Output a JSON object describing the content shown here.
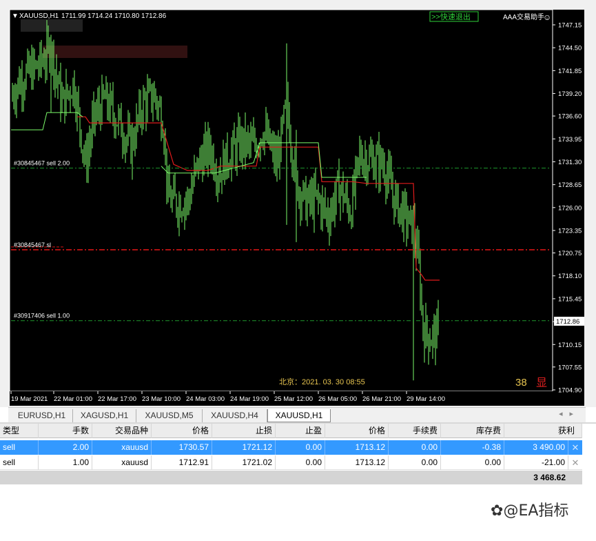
{
  "chart": {
    "symbol_info": "XAUUSD,H1",
    "ohlc": "1711.99 1714.24 1710.80 1712.86",
    "quick_exit_label": ">>快速退出",
    "assistant_label": "AAA交易助手",
    "beijing_time": "北京：2021. 03. 30  08:55",
    "counter": "38",
    "show_label": "显",
    "price_ticks": [
      "1747.15",
      "1744.50",
      "1741.85",
      "1739.20",
      "1736.60",
      "1733.95",
      "1731.30",
      "1728.65",
      "1726.00",
      "1723.35",
      "1720.75",
      "1718.10",
      "1715.45",
      "1712.80",
      "1710.15",
      "1707.55",
      "1704.90"
    ],
    "current_price": "1712.86",
    "time_ticks": [
      "19 Mar 2021",
      "22 Mar 01:00",
      "22 Mar 17:00",
      "23 Mar 10:00",
      "24 Mar 03:00",
      "24 Mar 19:00",
      "25 Mar 12:00",
      "26 Mar 05:00",
      "26 Mar 21:00",
      "29 Mar 14:00"
    ],
    "order_lines": [
      {
        "label": "#30845467 sell 2.00",
        "price": 1730.57,
        "color": "#1e9a2e"
      },
      {
        "label": "#30845467 sl",
        "price": 1721.12,
        "color": "#d21414"
      },
      {
        "label": "#30917406 sell 1.00",
        "price": 1712.91,
        "color": "#1e9a2e"
      }
    ],
    "colors": {
      "background": "#000000",
      "candle": "#7CFC6A",
      "grid_text": "#ffffff",
      "sl": "#d21414",
      "entry": "#1e9a2e",
      "stop_trail": "#e01b1b",
      "highlight": "#e8c550"
    }
  },
  "tabs": [
    {
      "label": "EURUSD,H1",
      "active": false
    },
    {
      "label": "XAGUSD,H1",
      "active": false
    },
    {
      "label": "XAUUSD,M5",
      "active": false
    },
    {
      "label": "XAUUSD,H4",
      "active": false
    },
    {
      "label": "XAUUSD,H1",
      "active": true
    }
  ],
  "terminal": {
    "headers": [
      "类型",
      "手数",
      "交易品种",
      "价格",
      "止损",
      "止盈",
      "价格",
      "手续费",
      "库存费",
      "获利"
    ],
    "rows": [
      [
        "sell",
        "2.00",
        "xauusd",
        "1730.57",
        "1721.12",
        "0.00",
        "1713.12",
        "0.00",
        "-0.38",
        "3 490.00"
      ],
      [
        "sell",
        "1.00",
        "xauusd",
        "1712.91",
        "1721.02",
        "0.00",
        "1713.12",
        "0.00",
        "0.00",
        "-21.00"
      ]
    ],
    "total_profit": "3 468.62"
  },
  "watermark": "@EA指标"
}
